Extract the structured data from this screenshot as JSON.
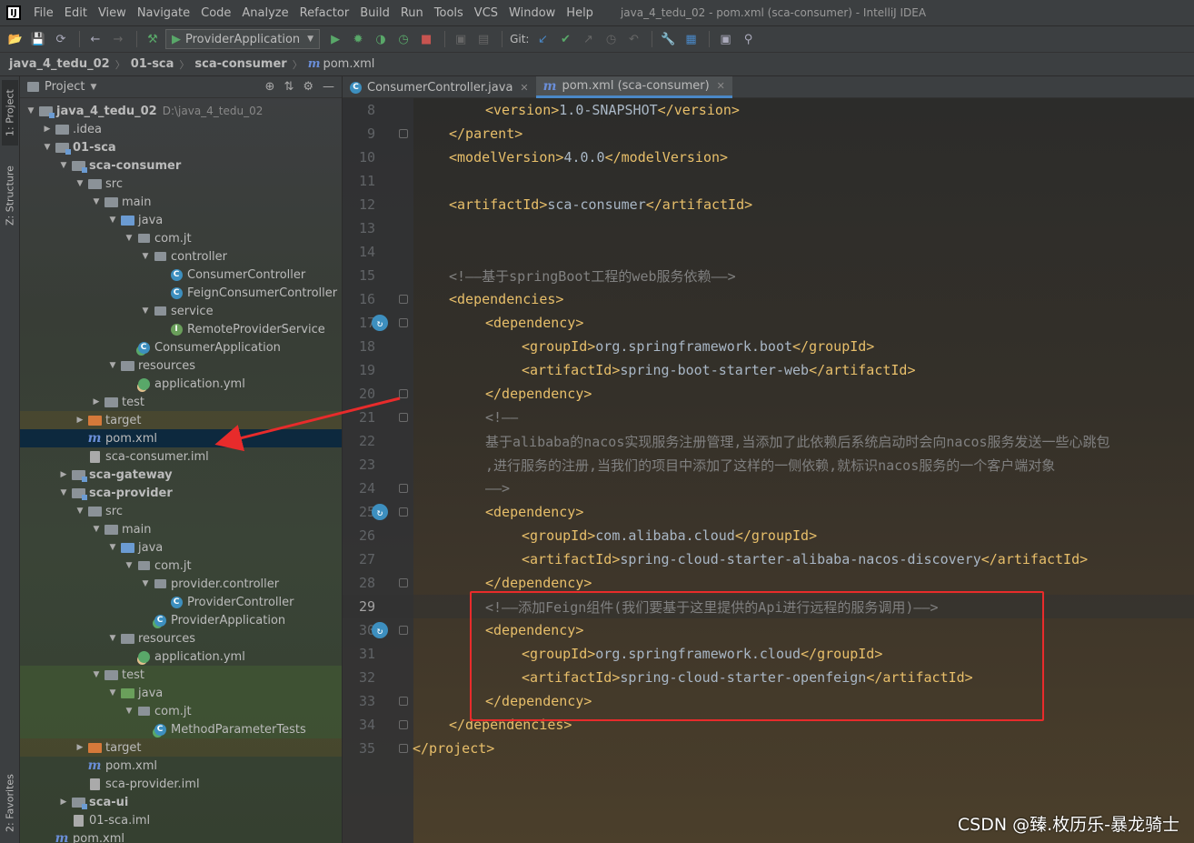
{
  "menubar": {
    "logo": "IJ",
    "items": [
      "File",
      "Edit",
      "View",
      "Navigate",
      "Code",
      "Analyze",
      "Refactor",
      "Build",
      "Run",
      "Tools",
      "VCS",
      "Window",
      "Help"
    ],
    "window_title": "java_4_tedu_02 - pom.xml (sca-consumer) - IntelliJ IDEA"
  },
  "toolbar": {
    "run_config": "ProviderApplication",
    "git_label": "Git:"
  },
  "breadcrumb": {
    "items": [
      "java_4_tedu_02",
      "01-sca",
      "sca-consumer"
    ],
    "file": "pom.xml",
    "file_icon": "m"
  },
  "left_strip": {
    "project_tab": "1: Project",
    "structure_tab": "Z: Structure",
    "favorites_tab": "2: Favorites"
  },
  "project_panel": {
    "title": "Project",
    "tree": [
      {
        "label": "java_4_tedu_02",
        "hint": "D:\\java_4_tedu_02",
        "icon": "module-folder",
        "bold": true
      },
      {
        "label": ".idea",
        "icon": "folder"
      },
      {
        "label": "01-sca",
        "icon": "module-folder",
        "bold": true
      },
      {
        "label": "sca-consumer",
        "icon": "module-folder",
        "bold": true
      },
      {
        "label": "src",
        "icon": "folder"
      },
      {
        "label": "main",
        "icon": "folder"
      },
      {
        "label": "java",
        "icon": "source-folder"
      },
      {
        "label": "com.jt",
        "icon": "package"
      },
      {
        "label": "controller",
        "icon": "package"
      },
      {
        "label": "ConsumerController",
        "icon": "class"
      },
      {
        "label": "FeignConsumerController",
        "icon": "class"
      },
      {
        "label": "service",
        "icon": "package"
      },
      {
        "label": "RemoteProviderService",
        "icon": "interface"
      },
      {
        "label": "ConsumerApplication",
        "icon": "spring-class"
      },
      {
        "label": "resources",
        "icon": "resources-folder"
      },
      {
        "label": "application.yml",
        "icon": "yml"
      },
      {
        "label": "test",
        "icon": "folder"
      },
      {
        "label": "target",
        "icon": "excluded-folder"
      },
      {
        "label": "pom.xml",
        "icon": "maven"
      },
      {
        "label": "sca-consumer.iml",
        "icon": "iml"
      },
      {
        "label": "sca-gateway",
        "icon": "module-folder",
        "bold": true
      },
      {
        "label": "sca-provider",
        "icon": "module-folder",
        "bold": true
      },
      {
        "label": "src",
        "icon": "folder"
      },
      {
        "label": "main",
        "icon": "folder"
      },
      {
        "label": "java",
        "icon": "source-folder"
      },
      {
        "label": "com.jt",
        "icon": "package"
      },
      {
        "label": "provider.controller",
        "icon": "package"
      },
      {
        "label": "ProviderController",
        "icon": "class"
      },
      {
        "label": "ProviderApplication",
        "icon": "spring-class"
      },
      {
        "label": "resources",
        "icon": "resources-folder"
      },
      {
        "label": "application.yml",
        "icon": "yml"
      },
      {
        "label": "test",
        "icon": "folder"
      },
      {
        "label": "java",
        "icon": "test-folder"
      },
      {
        "label": "com.jt",
        "icon": "package"
      },
      {
        "label": "MethodParameterTests",
        "icon": "spring-class"
      },
      {
        "label": "target",
        "icon": "excluded-folder"
      },
      {
        "label": "pom.xml",
        "icon": "maven"
      },
      {
        "label": "sca-provider.iml",
        "icon": "iml"
      },
      {
        "label": "sca-ui",
        "icon": "module-folder",
        "bold": true
      },
      {
        "label": "01-sca.iml",
        "icon": "iml"
      },
      {
        "label": "pom.xml",
        "icon": "maven"
      }
    ]
  },
  "editor": {
    "tabs": [
      {
        "label": "ConsumerController.java",
        "icon": "class",
        "active": false
      },
      {
        "label": "pom.xml (sca-consumer)",
        "icon": "maven",
        "active": true
      }
    ],
    "lines": [
      {
        "n": "8",
        "parts": [
          [
            "tag",
            "<version>"
          ],
          [
            "txt",
            "1.0-SNAPSHOT"
          ],
          [
            "tag",
            "</version>"
          ]
        ]
      },
      {
        "n": "9",
        "parts": [
          [
            "tag",
            "</parent>"
          ]
        ]
      },
      {
        "n": "10",
        "parts": [
          [
            "tag",
            "<modelVersion>"
          ],
          [
            "txt",
            "4.0.0"
          ],
          [
            "tag",
            "</modelVersion>"
          ]
        ]
      },
      {
        "n": "11",
        "parts": []
      },
      {
        "n": "12",
        "parts": [
          [
            "tag",
            "<artifactId>"
          ],
          [
            "txt",
            "sca-consumer"
          ],
          [
            "tag",
            "</artifactId>"
          ]
        ]
      },
      {
        "n": "13",
        "parts": []
      },
      {
        "n": "14",
        "parts": []
      },
      {
        "n": "15",
        "parts": [
          [
            "cmt",
            "<!——基于springBoot工程的web服务依赖——>"
          ]
        ]
      },
      {
        "n": "16",
        "parts": [
          [
            "tag",
            "<dependencies>"
          ]
        ]
      },
      {
        "n": "17",
        "parts": [
          [
            "tag",
            "<dependency>"
          ]
        ]
      },
      {
        "n": "18",
        "parts": [
          [
            "tag",
            "<groupId>"
          ],
          [
            "txt",
            "org.springframework.boot"
          ],
          [
            "tag",
            "</groupId>"
          ]
        ]
      },
      {
        "n": "19",
        "parts": [
          [
            "tag",
            "<artifactId>"
          ],
          [
            "txt",
            "spring-boot-starter-web"
          ],
          [
            "tag",
            "</artifactId>"
          ]
        ]
      },
      {
        "n": "20",
        "parts": [
          [
            "tag",
            "</dependency>"
          ]
        ]
      },
      {
        "n": "21",
        "parts": [
          [
            "cmt",
            "<!——"
          ]
        ]
      },
      {
        "n": "22",
        "parts": [
          [
            "cmt",
            "基于alibaba的nacos实现服务注册管理,当添加了此依赖后系统启动时会向nacos服务发送一些心跳包"
          ]
        ]
      },
      {
        "n": "23",
        "parts": [
          [
            "cmt",
            ",进行服务的注册,当我们的项目中添加了这样的一侧依赖,就标识nacos服务的一个客户端对象"
          ]
        ]
      },
      {
        "n": "24",
        "parts": [
          [
            "cmt",
            "——>"
          ]
        ]
      },
      {
        "n": "25",
        "parts": [
          [
            "tag",
            "<dependency>"
          ]
        ]
      },
      {
        "n": "26",
        "parts": [
          [
            "tag",
            "<groupId>"
          ],
          [
            "txt",
            "com.alibaba.cloud"
          ],
          [
            "tag",
            "</groupId>"
          ]
        ]
      },
      {
        "n": "27",
        "parts": [
          [
            "tag",
            "<artifactId>"
          ],
          [
            "txt",
            "spring-cloud-starter-alibaba-nacos-discovery"
          ],
          [
            "tag",
            "</artifactId>"
          ]
        ]
      },
      {
        "n": "28",
        "parts": [
          [
            "tag",
            "</dependency>"
          ]
        ]
      },
      {
        "n": "29",
        "parts": [
          [
            "cmt",
            "<!——添加Feign组件(我们要基于这里提供的Api进行远程的服务调用)——>"
          ]
        ]
      },
      {
        "n": "30",
        "parts": [
          [
            "tag",
            "<dependency>"
          ]
        ]
      },
      {
        "n": "31",
        "parts": [
          [
            "tag",
            "<groupId>"
          ],
          [
            "txt",
            "org.springframework.cloud"
          ],
          [
            "tag",
            "</groupId>"
          ]
        ]
      },
      {
        "n": "32",
        "parts": [
          [
            "tag",
            "<artifactId>"
          ],
          [
            "txt",
            "spring-cloud-starter-openfeign"
          ],
          [
            "tag",
            "</artifactId>"
          ]
        ]
      },
      {
        "n": "33",
        "parts": [
          [
            "tag",
            "</dependency>"
          ]
        ]
      },
      {
        "n": "34",
        "parts": [
          [
            "tag",
            "</dependencies>"
          ]
        ]
      },
      {
        "n": "35",
        "parts": [
          [
            "tag",
            "</project>"
          ]
        ]
      }
    ]
  },
  "watermark": "CSDN @臻.枚历乐-暴龙骑士",
  "colors": {
    "annotation_red": "#e82b2b",
    "xml_tag": "#e8bf6a",
    "comment": "#808080",
    "selection": "#0d293e"
  }
}
